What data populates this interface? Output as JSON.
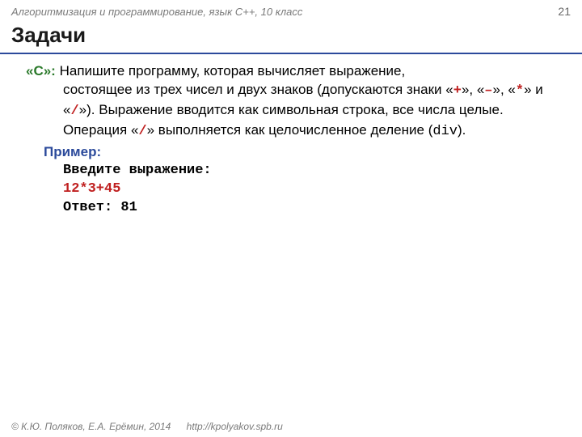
{
  "header": {
    "course": "Алгоритмизация и программирование, язык С++, 10 класс",
    "page": "21"
  },
  "title": "Задачи",
  "task": {
    "label": "«С»:",
    "text_start": " Напишите программу, которая вычисляет выражение,",
    "line2a": "состоящее из трех чисел и двух знаков (допускаются знаки «",
    "op_plus": "+",
    "sep1": "», «",
    "op_minus": "–",
    "sep2": "», «",
    "op_mul": "*",
    "sep3": "» и «",
    "op_div": "/",
    "line2b": "»). Выражение вводится как символьная строка, все числа целые. Операция «",
    "op_div2": "/",
    "line2c": "» выполняется как целочисленное деление (",
    "div_kw": "div",
    "line2d": ")."
  },
  "example": {
    "label": "Пример:",
    "prompt": "Введите выражение:",
    "expr": "12*3+45",
    "answer": "Ответ: 81"
  },
  "footer": {
    "copyright": "© К.Ю. Поляков, Е.А. Ерёмин, 2014",
    "url": "http://kpolyakov.spb.ru"
  }
}
